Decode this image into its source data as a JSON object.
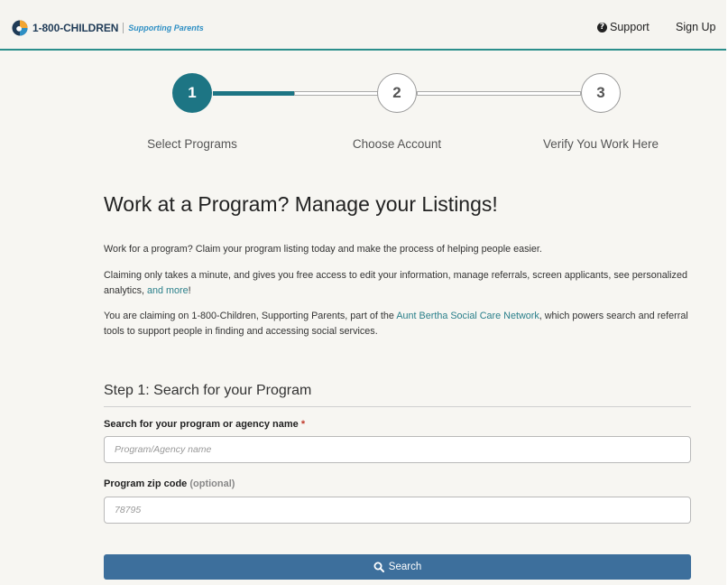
{
  "header": {
    "brand": "1-800-CHILDREN",
    "tagline": "Supporting Parents",
    "support_label": "Support",
    "signup_label": "Sign Up"
  },
  "stepper": {
    "steps": [
      {
        "number": "1",
        "label": "Select Programs",
        "active": true
      },
      {
        "number": "2",
        "label": "Choose Account",
        "active": false
      },
      {
        "number": "3",
        "label": "Verify You Work Here",
        "active": false
      }
    ]
  },
  "main": {
    "title": "Work at a Program? Manage your Listings!",
    "para1": "Work for a program? Claim your program listing today and make the process of helping people easier.",
    "para2_text": "Claiming only takes a minute, and gives you free access to edit your information, manage referrals, screen applicants, see personalized analytics, ",
    "para2_link": "and more",
    "para2_end": "!",
    "para3_start": "You are claiming on 1-800-Children, Supporting Parents, part of the ",
    "para3_link": "Aunt Bertha Social Care Network",
    "para3_end": ", which powers search and referral tools to support people in finding and accessing social services."
  },
  "form": {
    "section_title": "Step 1: Search for your Program",
    "name_label": "Search for your program or agency name",
    "required_mark": "*",
    "name_placeholder": "Program/Agency name",
    "zip_label": "Program zip code",
    "zip_optional": "(optional)",
    "zip_placeholder": "78795",
    "search_label": "Search"
  },
  "colors": {
    "accent": "#1d7584",
    "button": "#3d6f9c",
    "link": "#2a7f8a"
  }
}
